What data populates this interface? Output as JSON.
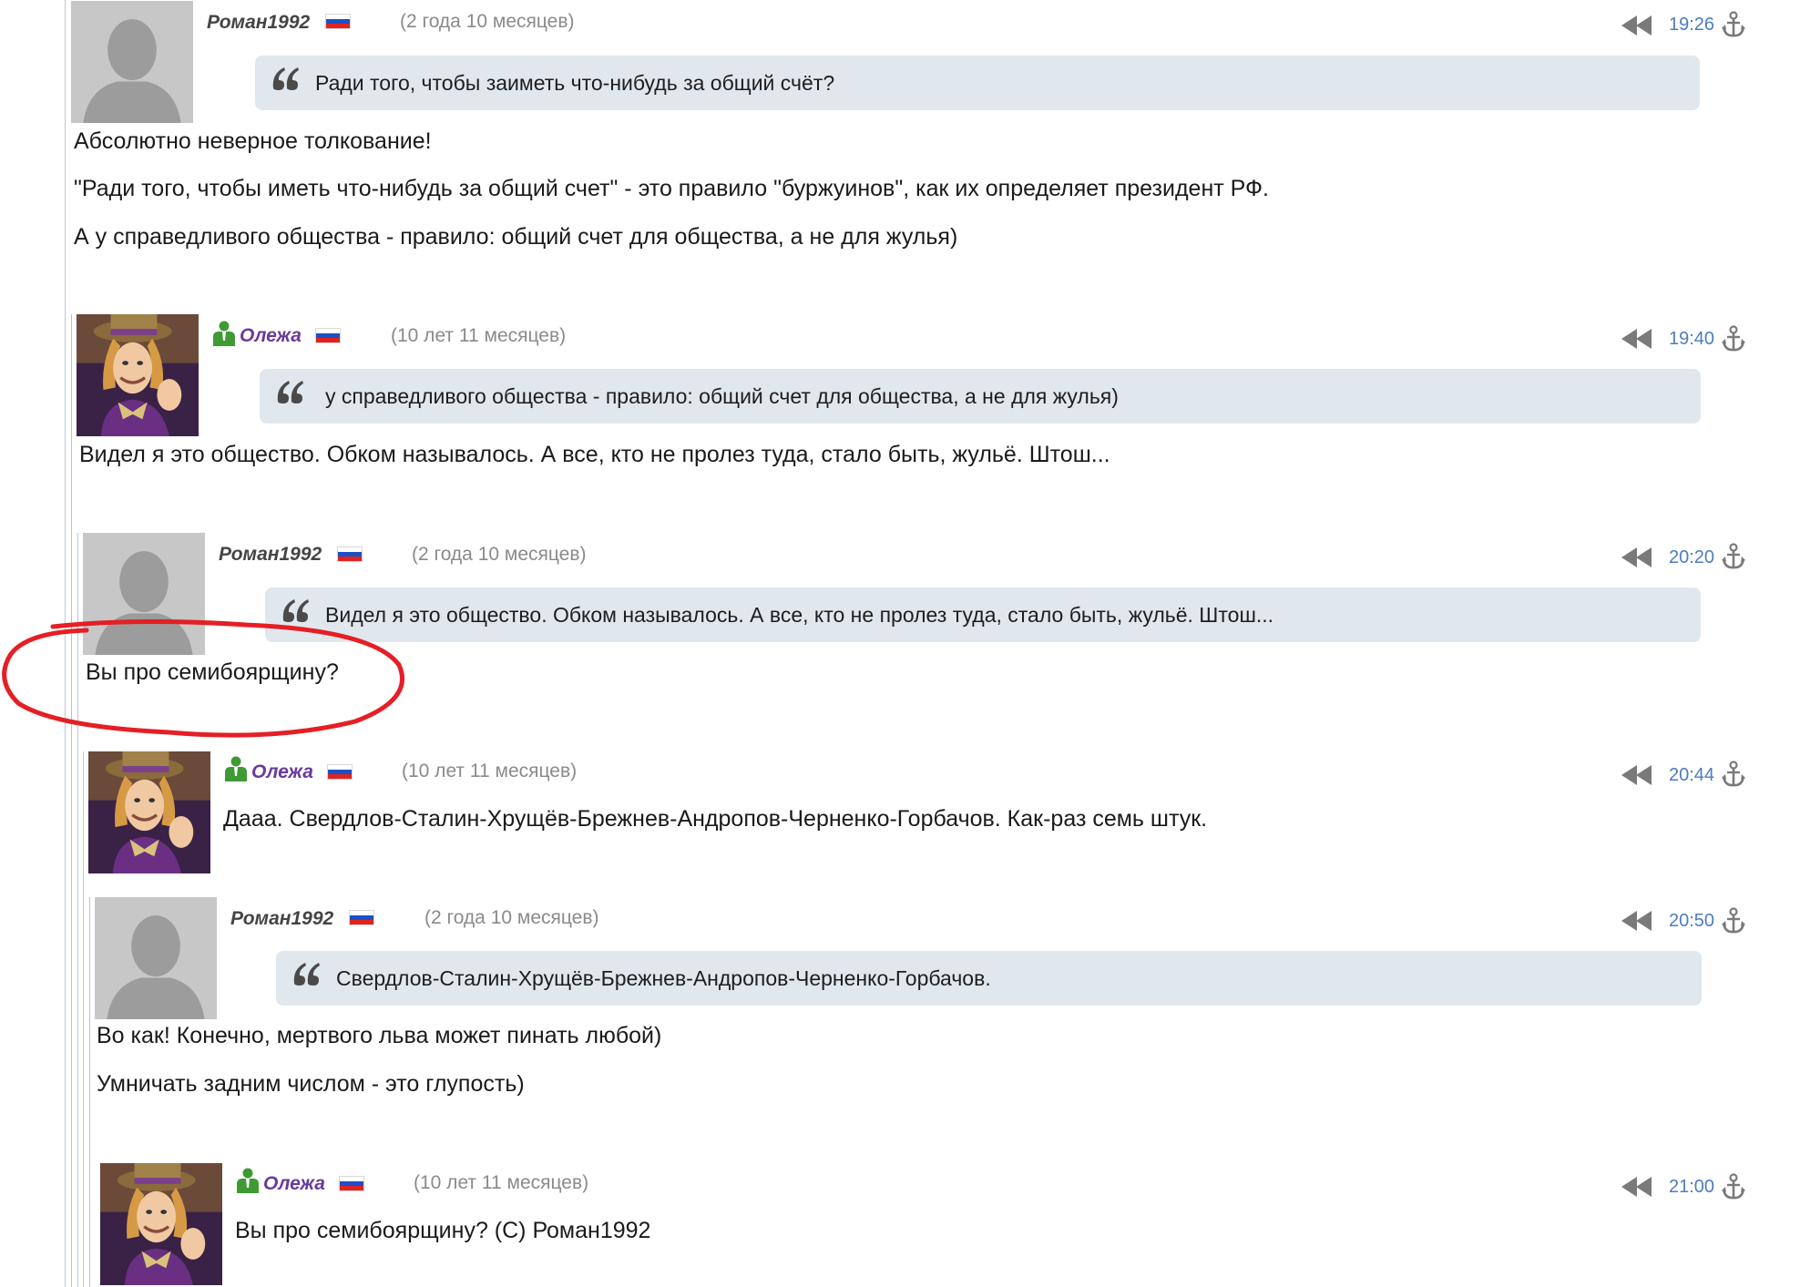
{
  "colors": {
    "quote_bg": "#e0e7ed",
    "nick_roman": "#444444",
    "nick_olezha": "#6a3a9c",
    "time_link": "#4d7cc2",
    "age_gray": "#8a8a8a",
    "annotation_red": "#e41f25"
  },
  "icons": {
    "reply": "rewind-icon",
    "anchor": "anchor-icon",
    "quote": "quote-icon",
    "user_status": "user-icon",
    "flag": "russia-flag-icon"
  },
  "comments": [
    {
      "author": "Роман1992",
      "age": "(2 года 10 месяцев)",
      "time": "19:26",
      "quote": "Ради того, чтобы заиметь что-нибудь за общий счёт?",
      "paragraphs": [
        "Абсолютно неверное толкование!",
        "\"Ради того, чтобы иметь что-нибудь за общий счет\" - это правило \"буржуинов\", как их определяет президент РФ.",
        "А у справедливого общества - правило: общий счет для общества, а не для жулья)"
      ]
    },
    {
      "author": "Олежа",
      "age": "(10 лет 11 месяцев)",
      "time": "19:40",
      "quote": "у справедливого общества - правило: общий счет для общества, а не для жулья)",
      "paragraphs": [
        "Видел я это общество. Обком называлось. А все, кто не пролез туда, стало быть, жульё. Штош..."
      ]
    },
    {
      "author": "Роман1992",
      "age": "(2 года 10 месяцев)",
      "time": "20:20",
      "quote": "Видел я это общество. Обком называлось. А все, кто не пролез туда, стало быть, жульё. Штош...",
      "paragraphs": [
        "Вы про семибоярщину?"
      ]
    },
    {
      "author": "Олежа",
      "age": "(10 лет 11 месяцев)",
      "time": "20:44",
      "paragraphs": [
        "Дааа. Свердлов-Сталин-Хрущёв-Брежнев-Андропов-Черненко-Горбачов. Как-раз семь штук."
      ]
    },
    {
      "author": "Роман1992",
      "age": "(2 года 10 месяцев)",
      "time": "20:50",
      "quote": "Свердлов-Сталин-Хрущёв-Брежнев-Андропов-Черненко-Горбачов.",
      "paragraphs": [
        "Во как! Конечно, мертвого льва может пинать любой)",
        "Умничать задним числом - это глупость)"
      ]
    },
    {
      "author": "Олежа",
      "age": "(10 лет 11 месяцев)",
      "time": "21:00",
      "paragraphs": [
        "Вы про семибоярщину? (С) Роман1992"
      ]
    }
  ]
}
